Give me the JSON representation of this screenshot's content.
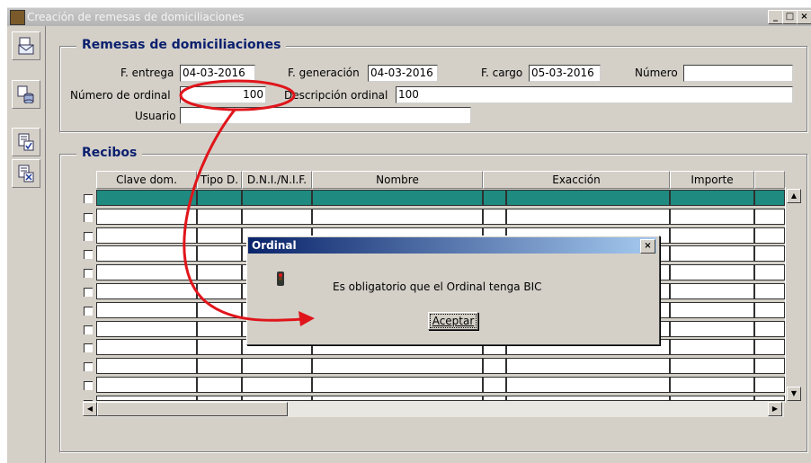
{
  "window": {
    "title": "Creación de remesas de domiciliaciones"
  },
  "toolbar": {
    "icons": [
      "envelope-doc-icon",
      "database-stack-icon",
      "doc-check-icon",
      "doc-cancel-icon"
    ]
  },
  "remesas": {
    "title": "Remesas de domiciliaciones",
    "f_entrega_label": "F. entrega",
    "f_entrega_value": "04-03-2016",
    "f_generacion_label": "F. generación",
    "f_generacion_value": "04-03-2016",
    "f_cargo_label": "F. cargo",
    "f_cargo_value": "05-03-2016",
    "numero_label": "Número",
    "numero_value": "",
    "numero_ordinal_label": "Número de ordinal",
    "numero_ordinal_value": "100",
    "descripcion_ordinal_label": "Descripción ordinal",
    "descripcion_ordinal_value": "100",
    "usuario_label": "Usuario",
    "usuario_value": ""
  },
  "recibos": {
    "title": "Recibos",
    "columns": [
      "Clave dom.",
      "Tipo D.",
      "D.N.I./N.I.F.",
      "Nombre",
      "Exacción",
      "Importe"
    ]
  },
  "dialog": {
    "title": "Ordinal",
    "message": "Es obligatorio que el Ordinal tenga BIC",
    "accept_label": "Aceptar",
    "close_glyph": "×"
  },
  "colors": {
    "title_bar_start": "#0a246a",
    "title_bar_end": "#a6caf0",
    "selected_row": "#1e8a80",
    "annotation": "#e0151b",
    "section_title": "#0a1f6e"
  }
}
